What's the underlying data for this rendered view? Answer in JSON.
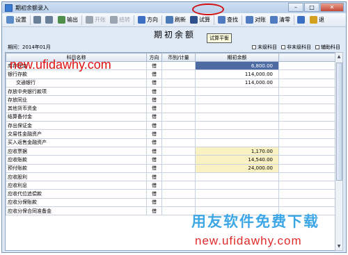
{
  "window": {
    "title": "期初余额录入",
    "min": "–",
    "max": "□",
    "close": "✕"
  },
  "toolbar": [
    {
      "name": "settings",
      "label": "设置",
      "icon": "settings-icon",
      "color": "#5b8bc9",
      "enabled": true
    },
    {
      "name": "print",
      "label": "",
      "icon": "print-icon",
      "color": "#6a7f99",
      "enabled": true
    },
    {
      "name": "preview",
      "label": "",
      "icon": "preview-icon",
      "color": "#6a7f99",
      "enabled": true
    },
    {
      "name": "output",
      "label": "输出",
      "icon": "output-icon",
      "color": "#4f8f4a",
      "enabled": true
    },
    {
      "name": "open-account",
      "label": "开账",
      "icon": "open-account-icon",
      "color": "#9aa4b0",
      "enabled": false
    },
    {
      "name": "close-account",
      "label": "结转",
      "icon": "close-account-icon",
      "color": "#9aa4b0",
      "enabled": false
    },
    {
      "name": "direction",
      "label": "方向",
      "icon": "direction-icon",
      "color": "#3a6fc4",
      "enabled": true
    },
    {
      "name": "refresh",
      "label": "刷新",
      "icon": "refresh-icon",
      "color": "#4a7ab8",
      "enabled": true
    },
    {
      "name": "trial-balance",
      "label": "试算",
      "icon": "trial-balance-icon",
      "color": "#2d4f8c",
      "enabled": true
    },
    {
      "name": "find",
      "label": "查找",
      "icon": "find-icon",
      "color": "#4f7cc0",
      "enabled": true
    },
    {
      "name": "reconcile",
      "label": "对账",
      "icon": "reconcile-icon",
      "color": "#4f7cc0",
      "enabled": true
    },
    {
      "name": "clear",
      "label": "清零",
      "icon": "clear-icon",
      "color": "#4f7cc0",
      "enabled": true
    },
    {
      "name": "help",
      "label": "",
      "icon": "help-icon",
      "color": "#3a6fc4",
      "enabled": true
    },
    {
      "name": "exit",
      "label": "退",
      "icon": "exit-icon",
      "color": "#d4a020",
      "enabled": true
    }
  ],
  "tooltip": "试算平衡",
  "heading": "期初余额",
  "period": "期间：2014年01月",
  "checks": [
    "末级科目",
    "非末级科目",
    "辅助科目"
  ],
  "columns": [
    "科目名称",
    "方向",
    "币别/计量",
    "期初余额"
  ],
  "rows": [
    {
      "name": "库存现金",
      "dir": "借",
      "unit": "",
      "bal": "6,800.00",
      "style": "sel",
      "indent": false
    },
    {
      "name": "银行存款",
      "dir": "借",
      "unit": "",
      "bal": "114,000.00",
      "style": "",
      "indent": false
    },
    {
      "name": "交通银行",
      "dir": "借",
      "unit": "",
      "bal": "114,000.00",
      "style": "",
      "indent": true
    },
    {
      "name": "存放中央银行款项",
      "dir": "借",
      "unit": "",
      "bal": "",
      "style": "",
      "indent": false
    },
    {
      "name": "存放同业",
      "dir": "借",
      "unit": "",
      "bal": "",
      "style": "",
      "indent": false
    },
    {
      "name": "其他货币资金",
      "dir": "借",
      "unit": "",
      "bal": "",
      "style": "",
      "indent": false
    },
    {
      "name": "结算备付金",
      "dir": "借",
      "unit": "",
      "bal": "",
      "style": "",
      "indent": false
    },
    {
      "name": "存出保证金",
      "dir": "借",
      "unit": "",
      "bal": "",
      "style": "",
      "indent": false
    },
    {
      "name": "交易性金融资产",
      "dir": "借",
      "unit": "",
      "bal": "",
      "style": "",
      "indent": false
    },
    {
      "name": "买入返售金融资产",
      "dir": "借",
      "unit": "",
      "bal": "",
      "style": "",
      "indent": false
    },
    {
      "name": "应收票据",
      "dir": "借",
      "unit": "",
      "bal": "1,170.00",
      "style": "yellow",
      "indent": false
    },
    {
      "name": "应收账款",
      "dir": "借",
      "unit": "",
      "bal": "14,540.00",
      "style": "yellow",
      "indent": false
    },
    {
      "name": "预付账款",
      "dir": "借",
      "unit": "",
      "bal": "24,000.00",
      "style": "yellow",
      "indent": false
    },
    {
      "name": "应收股利",
      "dir": "借",
      "unit": "",
      "bal": "",
      "style": "",
      "indent": false
    },
    {
      "name": "应收利息",
      "dir": "借",
      "unit": "",
      "bal": "",
      "style": "",
      "indent": false
    },
    {
      "name": "应收代位追偿款",
      "dir": "借",
      "unit": "",
      "bal": "",
      "style": "",
      "indent": false
    },
    {
      "name": "应收分保账款",
      "dir": "借",
      "unit": "",
      "bal": "",
      "style": "",
      "indent": false
    },
    {
      "name": "应收分保合同准备金",
      "dir": "借",
      "unit": "",
      "bal": "",
      "style": "",
      "indent": false
    }
  ],
  "watermarks": {
    "top": "new.ufidawhy.com",
    "big": "用友软件免费下载",
    "bottom": "new.ufidawhy.com"
  }
}
